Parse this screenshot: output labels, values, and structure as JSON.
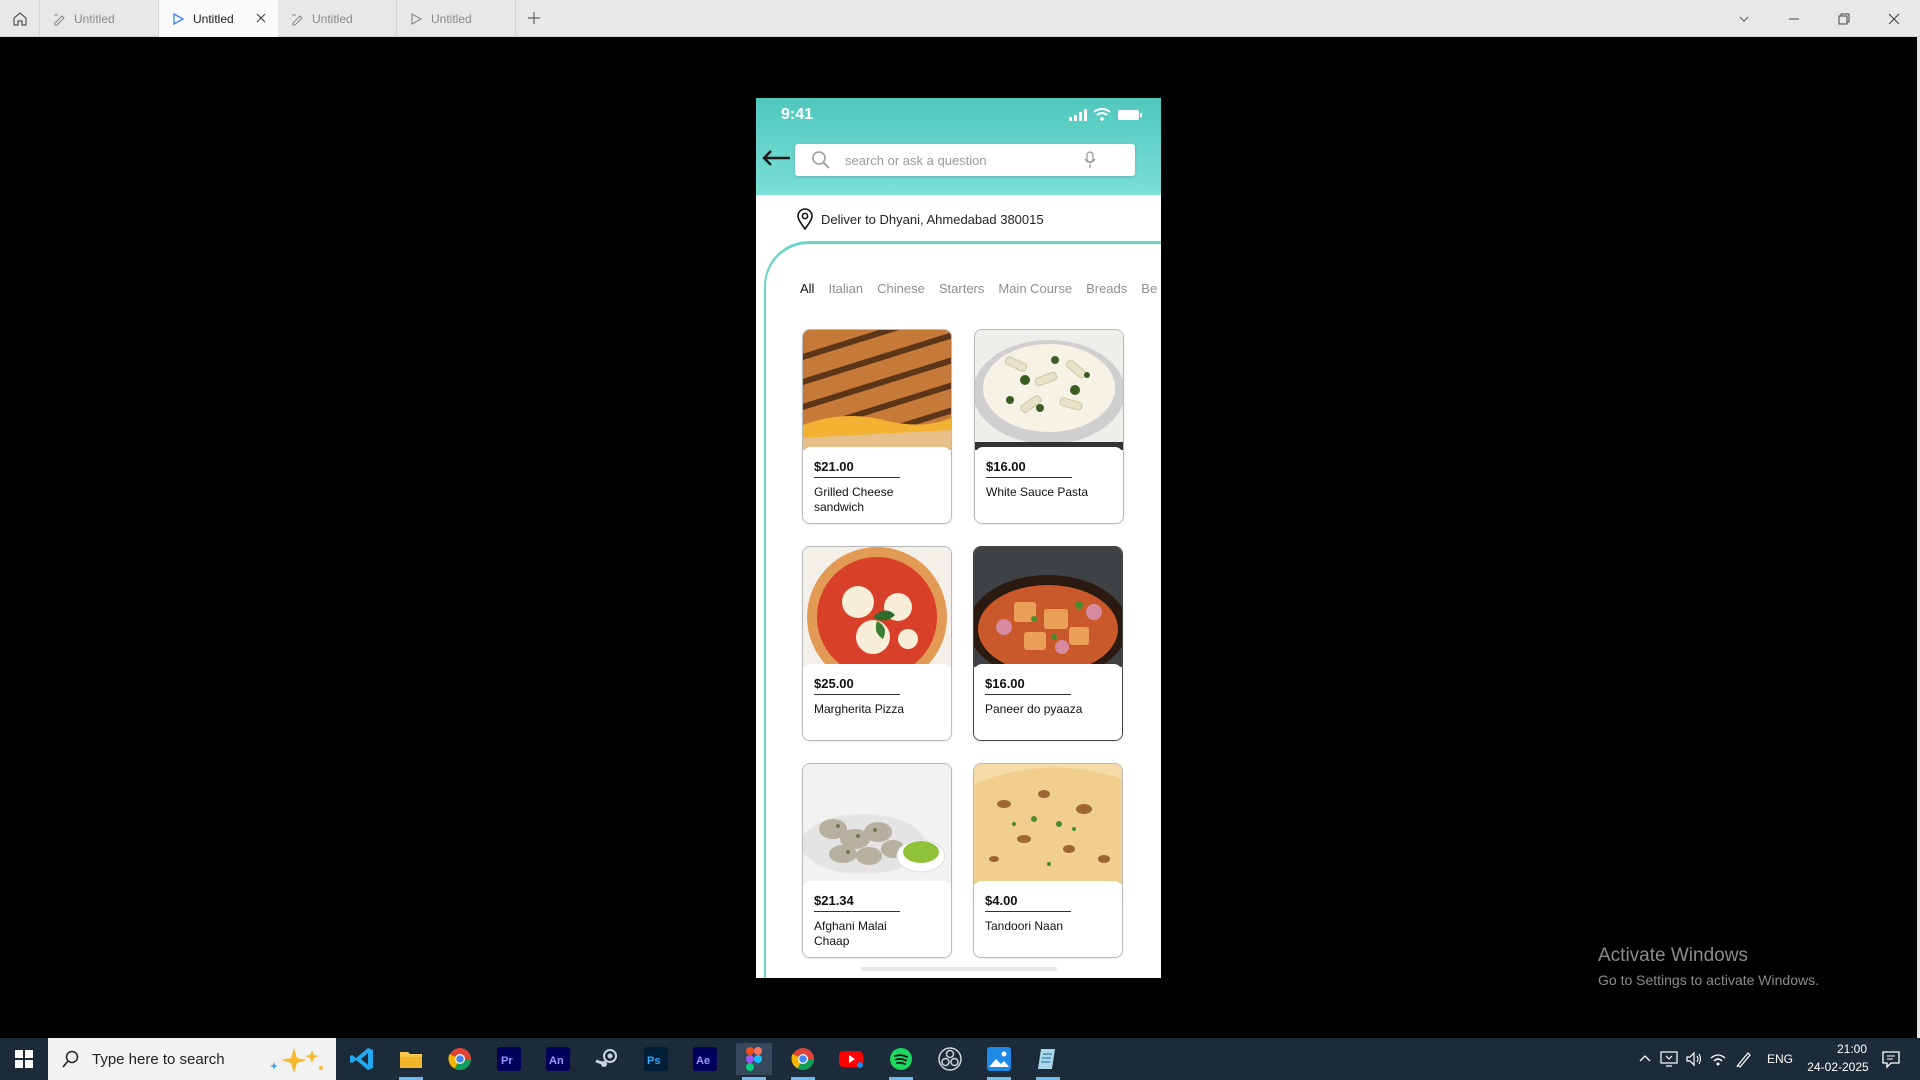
{
  "window": {
    "tabs": [
      {
        "label": "Untitled",
        "icon": "design-file-icon",
        "active": false
      },
      {
        "label": "Untitled",
        "icon": "prototype-play-icon",
        "active": true
      },
      {
        "label": "Untitled",
        "icon": "design-file-icon",
        "active": false
      },
      {
        "label": "Untitled",
        "icon": "prototype-play-icon",
        "active": false
      }
    ]
  },
  "phone": {
    "status_time": "9:41",
    "search": {
      "placeholder": "search or ask a question"
    },
    "deliver": "Deliver to Dhyani, Ahmedabad 380015",
    "categories": [
      "All",
      "Italian",
      "Chinese",
      "Starters",
      "Main Course",
      "Breads",
      "Be"
    ],
    "active_category": "All",
    "items": [
      {
        "price": "$21.00",
        "name": "Grilled Cheese sandwich",
        "image": "grilled-cheese-sandwich"
      },
      {
        "price": "$16.00",
        "name": "White Sauce Pasta",
        "image": "white-sauce-pasta"
      },
      {
        "price": "$25.00",
        "name": "Margherita Pizza",
        "image": "margherita-pizza"
      },
      {
        "price": "$16.00",
        "name": "Paneer do pyaaza",
        "image": "paneer-do-pyaaza"
      },
      {
        "price": "$21.34",
        "name": "Afghani Malai Chaap",
        "image": "afghani-malai-chaap"
      },
      {
        "price": "$4.00",
        "name": "Tandoori Naan",
        "image": "tandoori-naan"
      }
    ],
    "accent_color": "#5ccfc4"
  },
  "watermark": {
    "title": "Activate Windows",
    "subtitle": "Go to Settings to activate Windows."
  },
  "taskbar": {
    "search_placeholder": "Type here to search",
    "apps": [
      "vscode",
      "file-explorer",
      "chrome",
      "premiere-pro",
      "animate",
      "steam",
      "photoshop",
      "after-effects",
      "figma",
      "chrome-profile",
      "youtube",
      "spotify",
      "obs",
      "photos",
      "notepad"
    ],
    "language": "ENG",
    "time": "21:00",
    "date": "24-02-2025"
  }
}
